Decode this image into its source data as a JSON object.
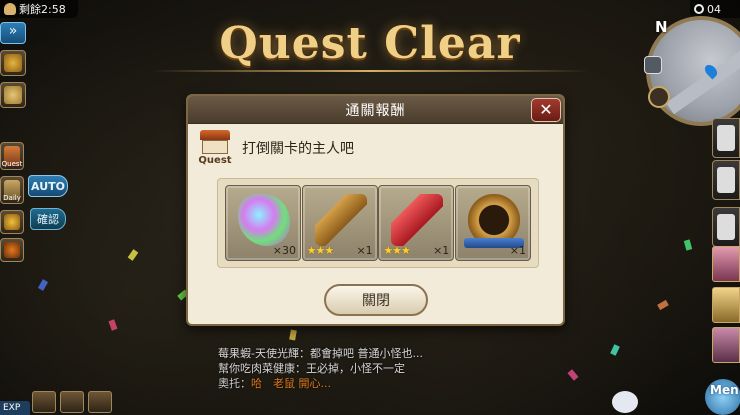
{
  "hud": {
    "timer_text": "剩餘2:58",
    "clock_text": "04",
    "minimap_compass": "N",
    "auto_label": "AUTO",
    "confirm_label": "確認",
    "quest_side_label": "Quest",
    "daily_side_label": "Daily",
    "exp_label": "EXP",
    "menu_label": "Men"
  },
  "banner": {
    "title": "Quest Clear"
  },
  "dialog": {
    "header": "通關報酬",
    "quest_icon_caption": "Quest",
    "quest_text": "打倒關卡的主人吧",
    "close_button_label": "關閉",
    "rewards": [
      {
        "name": "rainbow-gem",
        "stars": "",
        "qty": "×30"
      },
      {
        "name": "golden-spear-head",
        "stars": "★★★",
        "qty": "×1"
      },
      {
        "name": "red-crystal",
        "stars": "★★★",
        "qty": "×1"
      },
      {
        "name": "skill-emblem",
        "stars": "",
        "qty": "×1"
      }
    ]
  },
  "chat": {
    "line1": "莓果蝦-天使光輝：都會掉吧 普通小怪也...",
    "line2": "幫你吃肉菜健康：王必掉，小怪不一定",
    "line3_name": "奧托：",
    "line3_msg": "哈　老鼠   開心..."
  },
  "colors": {
    "title_gold": "#f0cf87",
    "dialog_bg": "#f2ebd9",
    "header_bg": "#5a4a38",
    "close_red": "#8a2a20",
    "star_yellow": "#ffcf2e"
  }
}
